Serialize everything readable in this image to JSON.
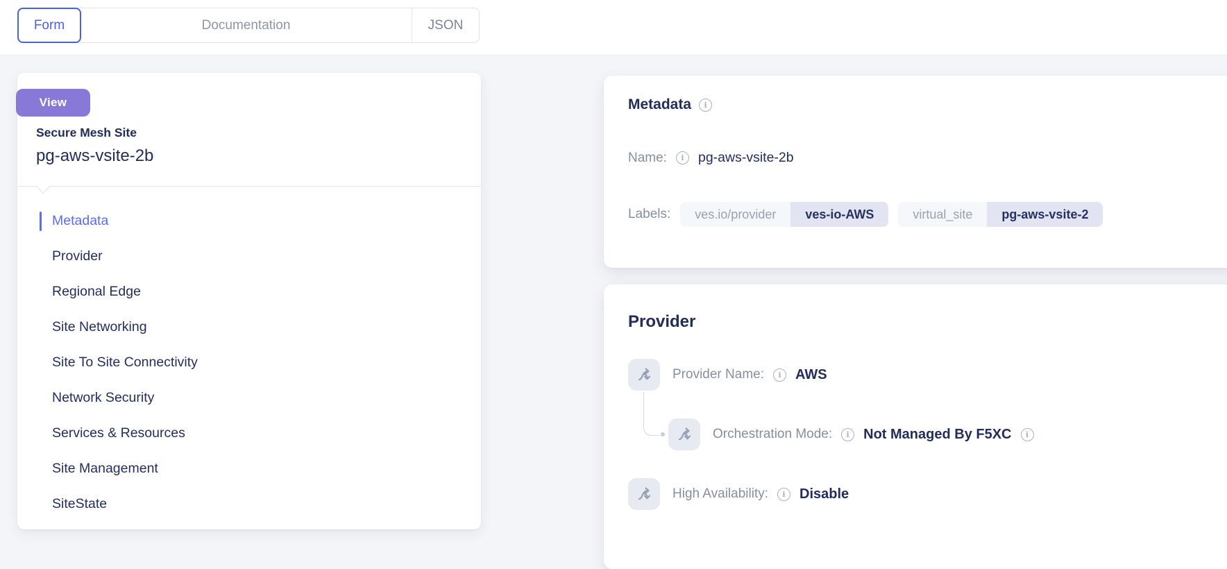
{
  "tabs": [
    {
      "label": "Form",
      "active": true
    },
    {
      "label": "Documentation",
      "active": false
    },
    {
      "label": "JSON",
      "active": false
    }
  ],
  "sidebar": {
    "badge_label": "View",
    "resource_type": "Secure Mesh Site",
    "resource_name": "pg-aws-vsite-2b",
    "items": [
      {
        "label": "Metadata",
        "active": true
      },
      {
        "label": "Provider",
        "active": false
      },
      {
        "label": "Regional Edge",
        "active": false
      },
      {
        "label": "Site Networking",
        "active": false
      },
      {
        "label": "Site To Site Connectivity",
        "active": false
      },
      {
        "label": "Network Security",
        "active": false
      },
      {
        "label": "Services & Resources",
        "active": false
      },
      {
        "label": "Site Management",
        "active": false
      },
      {
        "label": "SiteState",
        "active": false
      }
    ]
  },
  "metadata_card": {
    "title": "Metadata",
    "name_label": "Name:",
    "name_value": "pg-aws-vsite-2b",
    "labels_label": "Labels:",
    "labels": [
      {
        "key": "ves.io/provider",
        "value": "ves-io-AWS"
      },
      {
        "key": "virtual_site",
        "value": "pg-aws-vsite-2"
      }
    ]
  },
  "provider_card": {
    "title": "Provider",
    "rows": [
      {
        "label": "Provider Name:",
        "value": "AWS"
      },
      {
        "label": "Orchestration Mode:",
        "value": "Not Managed By F5XC"
      },
      {
        "label": "High Availability:",
        "value": "Disable"
      }
    ]
  },
  "colors": {
    "accent_blue": "#4c5fe4",
    "active_item_blue": "#5a6cf0",
    "badge_purple": "#8879d9",
    "heading_navy": "#232d5c",
    "label_gray": "#868e9f",
    "pill_key_bg": "#f6f7fa",
    "pill_value_bg": "#e2e5f1",
    "icon_box_bg": "#e8eaf2",
    "page_bg": "#f4f5f8"
  }
}
